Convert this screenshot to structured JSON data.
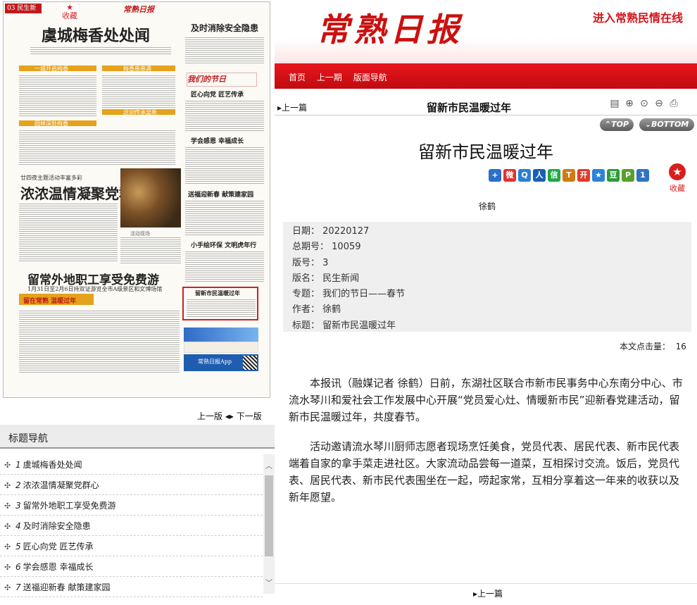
{
  "thumbnail": {
    "corner_label": "03",
    "section_label": "民生新闻",
    "masthead": "常熟日报",
    "collect_label": "收藏",
    "headline_main": "虞城梅香处处闻",
    "headline_safety": "及时消除安全隐患",
    "sub_heading_1": "一城开启梅香",
    "sub_heading_2": "梅香串串满",
    "sub_heading_3": "园林深处梅香",
    "sub_heading_4": "送训传承显新",
    "festival_logo": "我们的节日",
    "h_jiangxin": "匠心向党  匠艺传承",
    "h_xuehui": "学会感恩  幸福成长",
    "h_songfu": "送福迎新春  献策建家园",
    "h_xiaoshou": "小手绘环保  文明虎年行",
    "kicker": "廿四夜主题活动丰富多彩",
    "headline_dangqun": "浓浓温情凝聚党群心",
    "photo_caption": "活动现场",
    "headline_waidi": "留常外地职工享受免费游",
    "deck_waidi": "1月31日至2月6日持双证游览全市A级景区和文博场馆",
    "banner_small": "留在常熟 温暖过年",
    "box_title": "留新市民温暖过年",
    "ad_app": "常熟日报App"
  },
  "pager": {
    "prev": "上一版",
    "arrows": "◂▸",
    "next": "下一版"
  },
  "nav": {
    "title": "标题导航",
    "items": [
      {
        "num": "1",
        "label": "虞城梅香处处闻"
      },
      {
        "num": "2",
        "label": "浓浓温情凝聚党群心"
      },
      {
        "num": "3",
        "label": "留常外地职工享受免费游"
      },
      {
        "num": "4",
        "label": "及时消除安全隐患"
      },
      {
        "num": "5",
        "label": "匠心向党 匠艺传承"
      },
      {
        "num": "6",
        "label": "学会感恩 幸福成长"
      },
      {
        "num": "7",
        "label": "送福迎新春 献策建家园"
      }
    ]
  },
  "header": {
    "logo": "常熟日报",
    "enter_link": "进入常熟民情在线"
  },
  "menu": {
    "home": "首页",
    "prev_issue": "上一期",
    "layout_nav": "版面导航"
  },
  "toolbar": {
    "prev_article": "上一篇",
    "title": "留新市民温暖过年",
    "top": "TOP",
    "bottom": "BOTTOM"
  },
  "article": {
    "title": "留新市民温暖过年",
    "author": "徐鹤",
    "collect": "收藏",
    "meta": [
      {
        "key": "日期：",
        "value": "20220127"
      },
      {
        "key": "总期号：",
        "value": "10059"
      },
      {
        "key": "版号：",
        "value": "3"
      },
      {
        "key": "版名：",
        "value": "民生新闻"
      },
      {
        "key": "专题：",
        "value": "我们的节日——春节"
      },
      {
        "key": "作者：",
        "value": "徐鹤"
      },
      {
        "key": "标题：",
        "value": "留新市民温暖过年"
      }
    ],
    "hits_label": "本文点击量：",
    "hits_value": "16",
    "paragraphs": [
      "本报讯（融媒记者 徐鹤）日前，东湖社区联合市新市民事务中心东南分中心、市流水琴川和爱社会工作发展中心开展“党员爱心灶、情暖新市民”迎新春党建活动，留新市民温暖过年，共度春节。",
      "活动邀请流水琴川厨师志愿者现场烹饪美食，党员代表、居民代表、新市民代表端着自家的拿手菜走进社区。大家流动品尝每一道菜，互相探讨交流。饭后，党员代表、居民代表、新市民代表围坐在一起，唠起家常，互相分享着这一年来的收获以及新年愿望。"
    ],
    "prev_bottom": "上一篇"
  },
  "share_icons": [
    {
      "name": "add-share-icon",
      "glyph": "+",
      "color": "#2b6fc9"
    },
    {
      "name": "weibo-icon",
      "glyph": "微",
      "color": "#e0332c"
    },
    {
      "name": "qzone-icon",
      "glyph": "Q",
      "color": "#2a7fd6"
    },
    {
      "name": "renren-icon",
      "glyph": "人",
      "color": "#1a5fb4"
    },
    {
      "name": "wechat-icon",
      "glyph": "信",
      "color": "#1ea844"
    },
    {
      "name": "tieba-icon",
      "glyph": "T",
      "color": "#d07a10"
    },
    {
      "name": "kaixin-icon",
      "glyph": "开",
      "color": "#e23a2a"
    },
    {
      "name": "favorites-star-icon",
      "glyph": "★",
      "color": "#2c83d8"
    },
    {
      "name": "douban-icon",
      "glyph": "豆",
      "color": "#2e9b3c"
    },
    {
      "name": "print-share-icon",
      "glyph": "P",
      "color": "#58a02b"
    },
    {
      "name": "number-one-icon",
      "glyph": "1",
      "color": "#2f74c0"
    }
  ],
  "tool_icons": [
    "document-icon",
    "zoom-in-icon",
    "zoom-fit-icon",
    "zoom-out-icon",
    "print-icon"
  ],
  "colors": {
    "brand_red": "#d4141b",
    "menu_red": "#e8161c",
    "meta_bg": "#efefef",
    "band_orange": "#e5a21b"
  }
}
